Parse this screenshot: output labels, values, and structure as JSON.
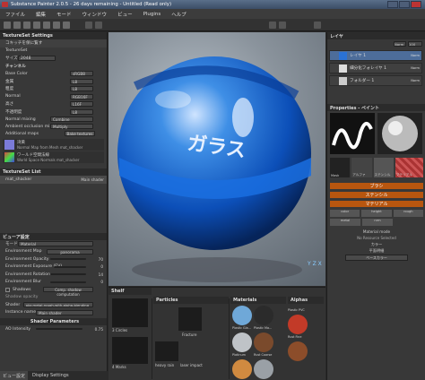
{
  "title": "Substance Painter 2.0.5 - 26 days remaining - Untitled (Read only)",
  "menu": [
    "ファイル",
    "編集",
    "モード",
    "ウィンドウ",
    "ビュー",
    "Plugins",
    "ヘルプ"
  ],
  "left": {
    "texset_settings_title": "TextureSet Settings",
    "texset_list_btn": "コキッチを保に覧す",
    "texset_name": "TextureSet",
    "size_label": "サイズ",
    "size_value": "2048",
    "channels_title": "チャンネル",
    "channels": [
      {
        "label": "Base Color",
        "value": "sRGB8"
      },
      {
        "label": "金属",
        "value": "L8"
      },
      {
        "label": "粗度",
        "value": "L8"
      },
      {
        "label": "Normal",
        "value": "RGB16F"
      },
      {
        "label": "高さ",
        "value": "L16F"
      },
      {
        "label": "不透明度",
        "value": "L8"
      }
    ],
    "normal_mixing_label": "Normal mixing",
    "normal_mixing_value": "Combine",
    "ao_mixing_label": "Ambient occlusion mixing",
    "ao_mixing_value": "Multiply",
    "additional_maps_label": "Additional maps",
    "bake_btn": "Bake textures",
    "map1_title": "湾黄",
    "map1_desc": "Normal Map from Mesh mat_shacker",
    "map2_title": "ワールド空間法線",
    "map2_desc": "World Space Normals mat_shacker",
    "texset_list_title": "TextureSet List",
    "texset_item": "mat_shacker",
    "texset_item_shader": "Main shader"
  },
  "bottomleft": {
    "display_title": "ビューア設定",
    "mode_label": "モード",
    "mode_value": "Material",
    "envmap_label": "Environment Map",
    "envmap_value": "panorama",
    "env_opacity": "Environment Opacity",
    "env_opacity_val": "70",
    "env_exposure": "Environment Exposure (EV)",
    "env_exposure_val": "0",
    "env_rotation": "Environment Rotation",
    "env_rotation_val": "14",
    "env_blur": "Environment Blur",
    "env_blur_val": "0",
    "shadows_label": "Shadows",
    "shadows_btn": "Comp. shadow computation",
    "shadow_opacity_label": "Shadow opacity",
    "shader_label": "Shader",
    "shader_value": "pbr-metal-rough-with-alpha-blending",
    "instance_label": "Instance name",
    "instance_value": "Main shader",
    "shader_params_title": "Shader Parameters",
    "ao_intensity_label": "AO Intensity",
    "ao_intensity_val": "0.75",
    "tab1": "ビュー設定",
    "tab2": "Display Settings"
  },
  "viewport": {
    "label_text": "ガラス",
    "coords": "Y Z X"
  },
  "right": {
    "layers_title": "レイヤ",
    "blend_mode": "Norm",
    "opacity": "100",
    "layers": [
      {
        "name": "レイヤ 1",
        "mode": "Norm",
        "opacity": "100"
      },
      {
        "name": "細分化フォレイヤ 1",
        "mode": "Norm",
        "opacity": "100"
      },
      {
        "name": "フォルダー 1",
        "mode": "Norm",
        "opacity": "100"
      }
    ],
    "props_title": "Properties - ペイント",
    "thumb_labels": [
      "Mask",
      "アルファ",
      "ステンシル",
      "マテリアル"
    ],
    "brush_bar": "ブラシ",
    "stencil_bar": "ステンシル",
    "material_bar": "マテリアル",
    "mat_channels": [
      "color",
      "height",
      "rough"
    ],
    "mat_channels2": [
      "metal",
      "nrm"
    ],
    "material_mode_label": "Material mode",
    "material_mode_value": "No Resource Selected",
    "color_label": "カラー",
    "uniform_label": "平面明細",
    "uniform_value": "ベースカラー"
  },
  "shelf": {
    "shelf_title": "Shelf",
    "particles_title": "Particles",
    "materials_title": "Materials",
    "alphas_title": "Alphas",
    "brush1": "3 Circles",
    "brush2": "4 Marks",
    "fracture_label": "Fracture",
    "heavy_label": "heavy rain",
    "laser_label": "laser impact",
    "materials": [
      {
        "name": "Plastic Gla...",
        "color": "#6fa8d8"
      },
      {
        "name": "Plastic Ma...",
        "color": "#2b2b2b"
      },
      {
        "name": "Plastic PVC",
        "color": "#c23a28"
      },
      {
        "name": "Platinum",
        "color": "#bfc3c7"
      },
      {
        "name": "Rust Coarse",
        "color": "#7a4a2c"
      },
      {
        "name": "Rust Fine",
        "color": "#8c4d2a"
      },
      {
        "name": "",
        "color": "#d08a40"
      },
      {
        "name": "",
        "color": "#9aa0a6"
      },
      {
        "name": "",
        "color": "#b7b9bb"
      }
    ]
  }
}
